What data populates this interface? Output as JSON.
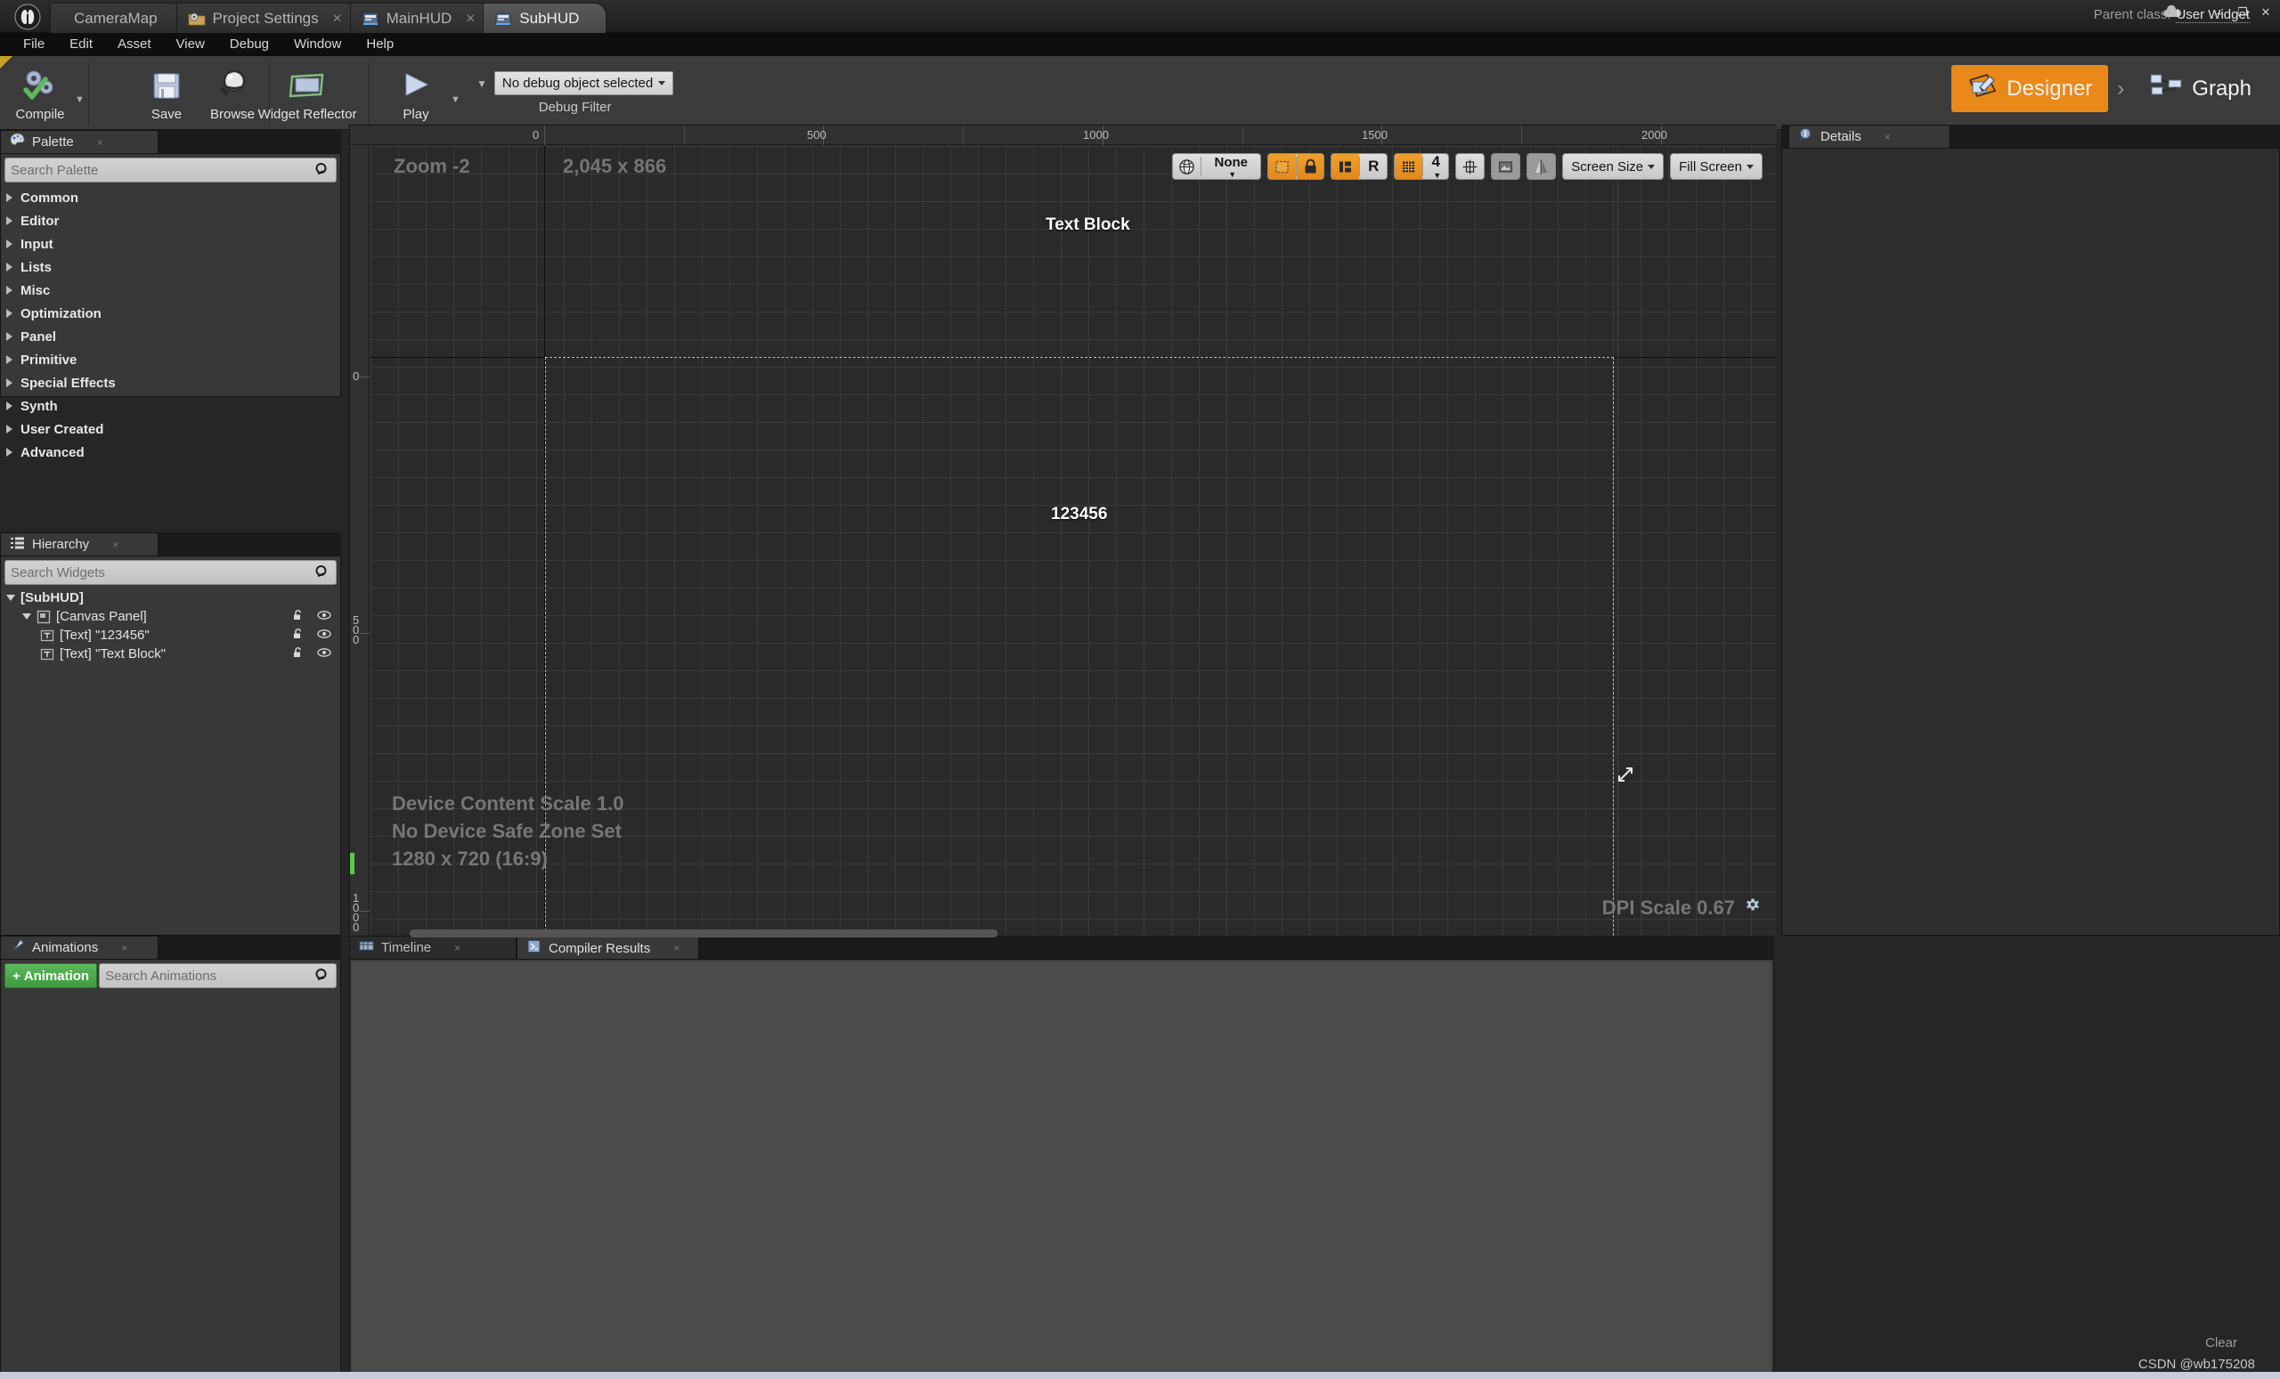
{
  "titlebar": {
    "logo": "ue-logo",
    "tabs": [
      {
        "label": "CameraMap",
        "icon": "map-icon",
        "closable": false,
        "state": "inactive"
      },
      {
        "label": "Project Settings",
        "icon": "project-settings-icon",
        "closable": true,
        "state": "inactive"
      },
      {
        "label": "MainHUD",
        "icon": "widget-blueprint-icon",
        "closable": true,
        "state": "inactive"
      },
      {
        "label": "SubHUD",
        "icon": "widget-blueprint-icon",
        "closable": false,
        "state": "active"
      }
    ],
    "parent_class_label": "Parent class:",
    "parent_class_value": "User Widget",
    "cloud_icon": "cloud-icon",
    "window_buttons": {
      "minimize": "–",
      "maximize": "❐",
      "close": "✕"
    }
  },
  "menubar": {
    "items": [
      "File",
      "Edit",
      "Asset",
      "View",
      "Debug",
      "Window",
      "Help"
    ]
  },
  "toolbar": {
    "compile": {
      "label": "Compile",
      "icon": "compile-gears-check-icon"
    },
    "save": {
      "label": "Save",
      "icon": "floppy-disk-icon"
    },
    "browse": {
      "label": "Browse",
      "icon": "magnifier-sphere-icon"
    },
    "widget_reflector": {
      "label": "Widget Reflector",
      "icon": "widget-reflector-icon"
    },
    "play": {
      "label": "Play",
      "icon": "play-triangle-icon"
    },
    "debug_object": {
      "value": "No debug object selected",
      "caption": "Debug Filter"
    },
    "modes": [
      {
        "label": "Designer",
        "icon": "designer-icon",
        "active": true
      },
      {
        "label": "Graph",
        "icon": "graph-nodes-icon",
        "active": false
      }
    ],
    "mode_separator": "›"
  },
  "palette": {
    "tab_label": "Palette",
    "tab_icon": "palette-icon",
    "close_icon": "×",
    "search_placeholder": "Search Palette",
    "search_value": "",
    "search_icon": "magnifier-icon",
    "categories": [
      "Common",
      "Editor",
      "Input",
      "Lists",
      "Misc",
      "Optimization",
      "Panel",
      "Primitive",
      "Special Effects",
      "Synth",
      "User Created",
      "Advanced"
    ]
  },
  "hierarchy": {
    "tab_label": "Hierarchy",
    "tab_icon": "hierarchy-icon",
    "close_icon": "×",
    "search_placeholder": "Search Widgets",
    "search_value": "",
    "search_icon": "magnifier-icon",
    "tree": [
      {
        "label": "[SubHUD]",
        "depth": 0,
        "expanded": true,
        "icon": null,
        "bold": true,
        "actions": false
      },
      {
        "label": "[Canvas Panel]",
        "depth": 1,
        "expanded": true,
        "icon": "canvas-panel-icon",
        "bold": false,
        "actions": true
      },
      {
        "label": "[Text] \"123456\"",
        "depth": 2,
        "expanded": null,
        "icon": "text-widget-icon",
        "bold": false,
        "actions": true
      },
      {
        "label": "[Text] \"Text Block\"",
        "depth": 2,
        "expanded": null,
        "icon": "text-widget-icon",
        "bold": false,
        "actions": true
      }
    ],
    "lock_icon": "unlocked-padlock-icon",
    "eye_icon": "eye-visibility-icon"
  },
  "animations": {
    "tab_label": "Animations",
    "tab_icon": "animation-icon",
    "close_icon": "×",
    "add_button_label": "Animation",
    "add_button_plus": "+",
    "search_placeholder": "Search Animations",
    "search_value": "",
    "search_icon": "magnifier-icon"
  },
  "details": {
    "tab_label": "Details",
    "tab_icon": "details-info-icon",
    "close_icon": "×"
  },
  "bottom_panel": {
    "tabs": [
      {
        "label": "Timeline",
        "icon": "timeline-icon",
        "active": false,
        "close_icon": "×"
      },
      {
        "label": "Compiler Results",
        "icon": "compiler-results-icon",
        "active": true,
        "close_icon": "×"
      }
    ],
    "clear_label": "Clear"
  },
  "viewport": {
    "zoom_label": "Zoom -2",
    "dimensions_label": "2,045 x 866",
    "device_content_scale": "Device Content Scale 1.0",
    "safe_zone": "No Device Safe Zone Set",
    "resolution": "1280 x 720 (16:9)",
    "dpi_scale": "DPI Scale 0.67",
    "dpi_settings_icon": "gear-icon",
    "resize_handle_icon": "resize-diagonal-icon",
    "ruler_top_labels": [
      {
        "text": "0",
        "pos": 0
      },
      {
        "text": "500",
        "pos": 500
      },
      {
        "text": "1000",
        "pos": 1000
      },
      {
        "text": "1500",
        "pos": 1500
      },
      {
        "text": "2000",
        "pos": 2000
      }
    ],
    "ruler_left_labels": [
      {
        "text": "0",
        "pos": 0
      },
      {
        "text": "500",
        "pos": 500
      },
      {
        "text": "1000",
        "pos": 1000
      }
    ],
    "toolbar": {
      "globe_icon": "localization-globe-icon",
      "none_dropdown": "None",
      "dashed_rect_icon": "outline-widget-icon",
      "lock_icon": "locked-padlock-icon",
      "layout_icon": "fill-layout-icon",
      "r_button": "R",
      "grid_icon": "snap-grid-icon",
      "grid_size": "4",
      "transform_icon": "transform-widget-icon",
      "image_icon": "image-preview-icon",
      "mirror_icon": "mirror-icon",
      "screen_size": "Screen Size",
      "fill_screen": "Fill Screen"
    },
    "canvas_widgets": [
      {
        "name": "text-block-widget",
        "text": "Text Block"
      },
      {
        "name": "text-123456-widget",
        "text": "123456"
      }
    ]
  },
  "watermark": "CSDN @wb175208"
}
